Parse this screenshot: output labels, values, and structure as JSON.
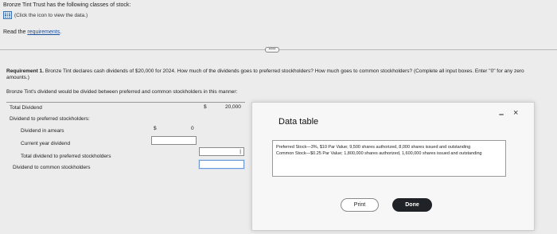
{
  "header": {
    "intro": "Bronze Tint Trust has the following classes of stock:",
    "data_link": "(Click the icon to view the data.)",
    "read_prefix": "Read the ",
    "read_link": "requirements",
    "read_suffix": "."
  },
  "handle_label": "•••••",
  "requirement": {
    "label": "Requirement 1.",
    "text": " Bronze Tint declares cash dividends of $20,000 for 2024. How much of the dividends goes to preferred stockholders? How much goes to common stockholders? (Complete all input boxes. Enter \"0\" for any zero amounts.)"
  },
  "split_text": "Bronze Tint's dividend would be divided between preferred and common stockholders in this manner:",
  "table": {
    "total_dividend": "Total Dividend",
    "total_currency": "$",
    "total_value": "20,000",
    "dividend_to_preferred": "Dividend to preferred stockholders:",
    "dividend_in_arrears": "Dividend in arrears",
    "arrears_currency": "$",
    "arrears_value": "0",
    "current_year_dividend": "Current year dividend",
    "total_to_preferred": "Total dividend to preferred stockholders",
    "dividend_to_common": "Dividend to common stockholders"
  },
  "modal": {
    "title": "Data table",
    "minimize": "–",
    "close": "×",
    "preferred": "Preferred Stock—3%, $10 Par Value; 9,500 shares authorized, 8,000 shares issued and outstanding",
    "common": "Common Stock—$0.25 Par Value; 1,800,000 shares authorized, 1,600,000 shares issued and outstanding",
    "print": "Print",
    "done": "Done"
  },
  "colors": {
    "accent": "#1a4fa0",
    "done_bg": "#1f2226",
    "focus": "#6b9ad6"
  }
}
